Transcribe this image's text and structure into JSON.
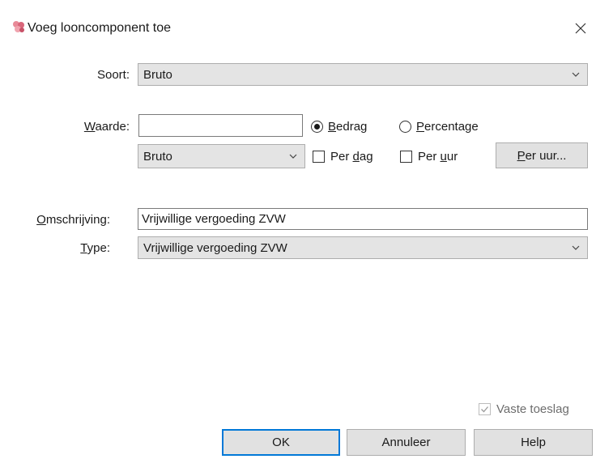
{
  "window": {
    "title": "Voeg looncomponent toe",
    "icon": "pink-flower-icon",
    "close_icon": "close-icon"
  },
  "soort": {
    "label": "Soort:",
    "value": "Bruto"
  },
  "waarde": {
    "label_prefix": "",
    "label_mnemonic": "W",
    "label_rest": "aarde:",
    "value": "",
    "unit_select": "Bruto",
    "radio_bedrag": {
      "mnemonic": "B",
      "rest": "edrag",
      "selected": true
    },
    "radio_percentage": {
      "mnemonic": "P",
      "rest": "ercentage",
      "selected": false
    },
    "check_per_dag": {
      "prefix": "Per ",
      "mnemonic": "d",
      "rest": "ag",
      "checked": false
    },
    "check_per_uur": {
      "prefix": "Per ",
      "mnemonic": "u",
      "rest": "ur",
      "checked": false
    },
    "per_uur_button": {
      "mnemonic": "P",
      "rest": "er uur..."
    }
  },
  "omschrijving": {
    "label_mnemonic": "O",
    "label_rest": "mschrijving:",
    "value": "Vrijwillige vergoeding ZVW"
  },
  "type": {
    "label_mnemonic": "T",
    "label_rest": "ype:",
    "value": "Vrijwillige vergoeding ZVW"
  },
  "vaste_toeslag": {
    "label": "Vaste toeslag",
    "checked": true,
    "enabled": false
  },
  "buttons": {
    "ok": "OK",
    "annuleer": "Annuleer",
    "help": "Help"
  },
  "colors": {
    "accent": "#0078d7",
    "combo_bg": "#e4e4e4",
    "button_bg": "#e1e1e1"
  }
}
